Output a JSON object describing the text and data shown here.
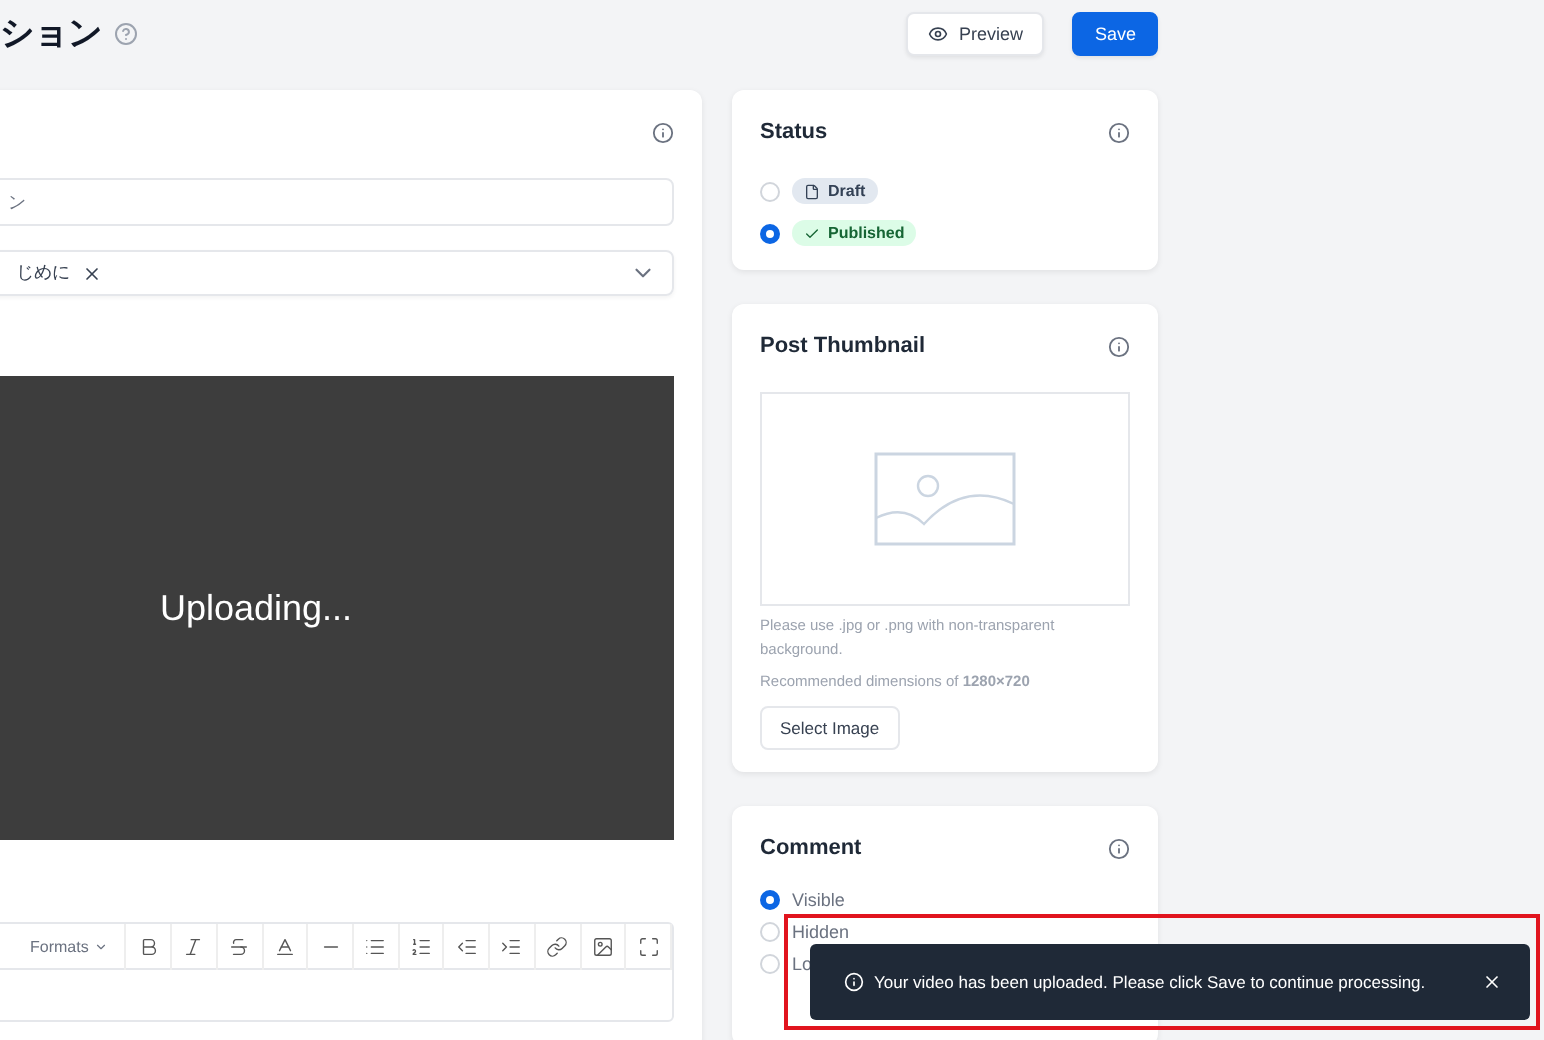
{
  "header": {
    "title": "ション",
    "buttons": [
      {
        "label": "Preview",
        "kind": "secondary"
      },
      {
        "label": "Save",
        "kind": "primary"
      }
    ]
  },
  "editor": {
    "title_value": "ン",
    "tags": [
      "じめに"
    ],
    "video": {
      "message": "Uploading..."
    },
    "toolbar": {
      "formats": "Formats"
    }
  },
  "status": {
    "title": "Status",
    "options": [
      {
        "label": "Draft",
        "kind": "draft",
        "selected": false
      },
      {
        "label": "Published",
        "kind": "published",
        "selected": true
      }
    ]
  },
  "thumbnail": {
    "title": "Post Thumbnail",
    "hint": "Please use .jpg or .png with non-transparent background.",
    "dimensions": "Recommended dimensions of **1280×720**",
    "button": "Select Image"
  },
  "comment": {
    "title": "Comment",
    "options": [
      {
        "label": "Visible",
        "selected": true
      },
      {
        "label": "Hidden",
        "selected": false
      },
      {
        "label": "Lo",
        "selected": false
      }
    ]
  },
  "toast": {
    "message": "Your video has been uploaded. Please click Save to continue processing.",
    "highlighted": true
  }
}
